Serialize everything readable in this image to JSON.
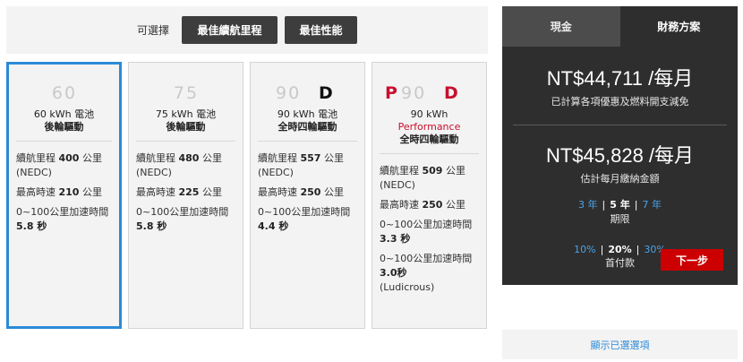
{
  "selector": {
    "label": "可選擇",
    "range_button": "最佳續航里程",
    "performance_button": "最佳性能"
  },
  "cards": [
    {
      "badge": "60",
      "battery": "60 kWh 電池",
      "drive": "後輪驅動",
      "range_prefix": "續航里程",
      "range_value": "400",
      "range_unit": "公里 (NEDC)",
      "speed_prefix": "最高時速",
      "speed_value": "210",
      "speed_unit": "公里",
      "accel_prefix": "0~100公里加速時間",
      "accel_value": "5.8 秒"
    },
    {
      "badge": "75",
      "battery": "75 kWh 電池",
      "drive": "後輪驅動",
      "range_prefix": "續航里程",
      "range_value": "480",
      "range_unit": "公里 (NEDC)",
      "speed_prefix": "最高時速",
      "speed_value": "225",
      "speed_unit": "公里",
      "accel_prefix": "0~100公里加速時間",
      "accel_value": "5.8 秒"
    },
    {
      "badge": "90D",
      "battery": "90 kWh 電池",
      "drive": "全時四輪驅動",
      "range_prefix": "續航里程",
      "range_value": "557",
      "range_unit": "公里 (NEDC)",
      "speed_prefix": "最高時速",
      "speed_value": "250",
      "speed_unit": "公里",
      "accel_prefix": "0~100公里加速時間",
      "accel_value": "4.4 秒"
    },
    {
      "badge": "P90D",
      "battery": "90 kWh",
      "perf_name": "Performance",
      "drive": "全時四輪驅動",
      "range_prefix": "續航里程",
      "range_value": "509",
      "range_unit": "公里 (NEDC)",
      "speed_prefix": "最高時速",
      "speed_value": "250",
      "speed_unit": "公里",
      "accel_prefix": "0~100公里加速時間",
      "accel_value": "3.3 秒",
      "accel2_prefix": "0~100公里加速時間",
      "accel2_value": "3.0秒",
      "accel2_note": "(Ludicrous)"
    }
  ],
  "panel": {
    "tabs": [
      "現金",
      "財務方案"
    ],
    "active_tab": "財務方案",
    "price1": "NT$44,711 /每月",
    "price1_sub": "已計算各項優惠及燃料開支減免",
    "price2": "NT$45,828 /每月",
    "price2_sub": "估計每月繳納金額",
    "terms": [
      "3 年",
      "5 年",
      "7 年"
    ],
    "terms_active": "5 年",
    "terms_caption": "期限",
    "downpayments": [
      "10%",
      "20%",
      "30%"
    ],
    "downpayment_active": "20%",
    "downpayment_caption": "首付款",
    "next_button": "下一步"
  },
  "show_options": "顯示已選選項",
  "colors": {
    "accent_blue": "#2b8ad8",
    "red": "#cc0000",
    "panel_bg": "#2e2e2e"
  }
}
